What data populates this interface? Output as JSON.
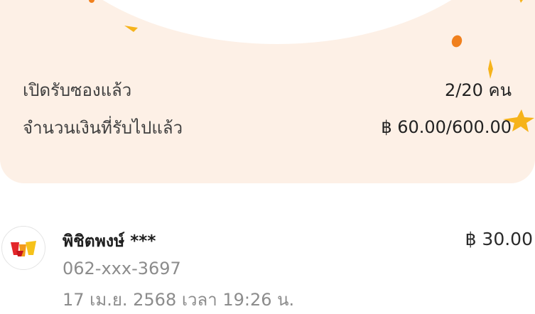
{
  "summary": {
    "opened_label": "เปิดรับซองแล้ว",
    "opened_value": "2/20 คน",
    "amount_label": "จำนวนเงินที่รับไปแล้ว",
    "amount_value": "฿ 60.00/600.00"
  },
  "claims": [
    {
      "name": "พิชิตพงษ์ ***",
      "amount": "฿ 30.00",
      "phone": "062-xxx-3697",
      "time": "17 เม.ย. 2568 เวลา 19:26 น.",
      "avatar_icon": "truemoney-wallet-logo-icon"
    }
  ],
  "colors": {
    "card_background": "#fdf0e6",
    "confetti_orange": "#f0801e",
    "confetti_yellow": "#f6b31b",
    "secondary_text": "#8c8c8c"
  }
}
